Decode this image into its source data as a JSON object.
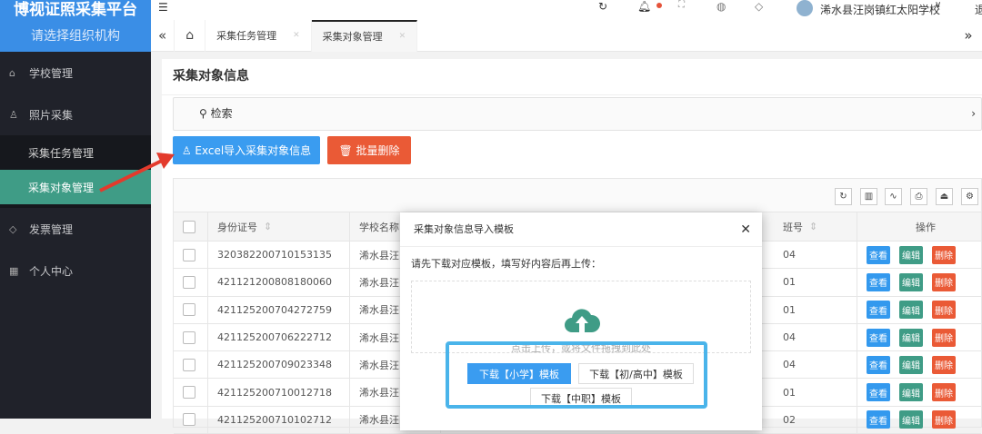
{
  "sidebar": {
    "title": "博视证照采集平台",
    "org_placeholder": "请选择组织机构",
    "items": [
      {
        "label": "学校管理",
        "icon": "home-icon"
      },
      {
        "label": "照片采集",
        "icon": "user-icon"
      },
      {
        "label": "采集任务管理"
      },
      {
        "label": "采集对象管理"
      },
      {
        "label": "发票管理",
        "icon": "tag-icon"
      },
      {
        "label": "个人中心",
        "icon": "grid-icon"
      }
    ]
  },
  "header": {
    "user": "浠水县汪岗镇红太阳学校",
    "extra": "退"
  },
  "tabs": [
    {
      "label": "采集任务管理"
    },
    {
      "label": "采集对象管理"
    }
  ],
  "card": {
    "title": "采集对象信息",
    "search": "检索",
    "import_btn": "Excel导入采集对象信息",
    "batch_delete_btn": "批量删除"
  },
  "table": {
    "headers": {
      "id": "身份证号",
      "school": "学校名称",
      "class": "班号",
      "ops": "操作"
    },
    "ops": {
      "view": "查看",
      "edit": "编辑",
      "delete": "删除"
    },
    "rows": [
      {
        "id": "320382200710153135",
        "school": "浠水县汪",
        "class": "04"
      },
      {
        "id": "421121200808180060",
        "school": "浠水县汪",
        "class": "01"
      },
      {
        "id": "421125200704272759",
        "school": "浠水县汪",
        "class": "01"
      },
      {
        "id": "421125200706222712",
        "school": "浠水县汪",
        "class": "04"
      },
      {
        "id": "421125200709023348",
        "school": "浠水县汪",
        "class": "04"
      },
      {
        "id": "421125200710012718",
        "school": "浠水县汪",
        "class": "01"
      },
      {
        "id": "421125200710102712",
        "school": "浠水县汪",
        "class": "02"
      }
    ]
  },
  "modal": {
    "title": "采集对象信息导入模板",
    "instruction": "请先下载对应模板，填写好内容后再上传：",
    "drop_hint": "点击上传，或将文件拖拽到此处",
    "dl_primary": "下载【小学】模板",
    "dl_middle": "下载【初/高中】模板",
    "dl_vocational": "下载【中职】模板"
  },
  "colors": {
    "primary": "#3a8ee6",
    "green": "#3f9c86",
    "red": "#ea5a36",
    "blue_btn": "#3399ee"
  }
}
